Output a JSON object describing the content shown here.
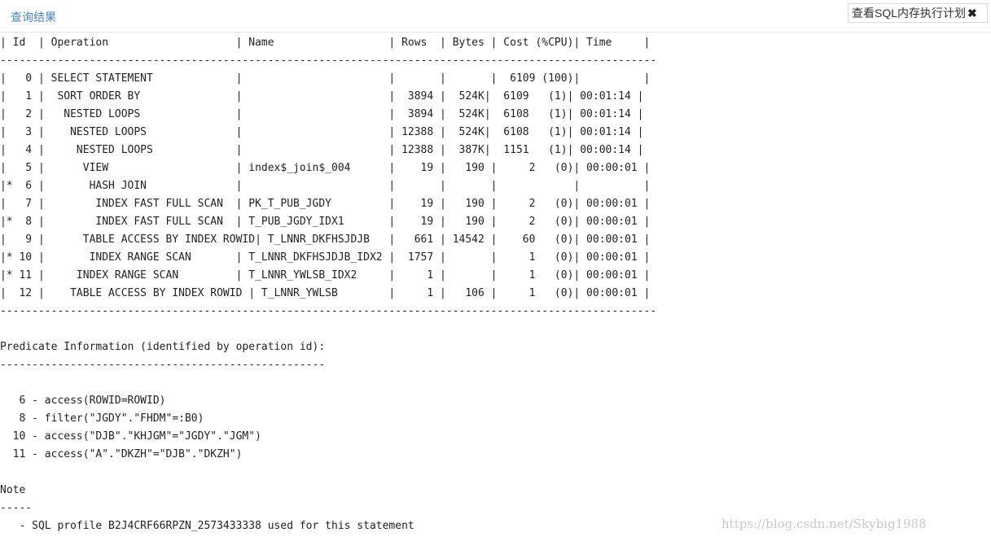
{
  "header": {
    "title": "查询结果",
    "button_label": "查看SQL内存执行计划",
    "close_glyph": "✖"
  },
  "plan": {
    "lines": [
      "| Id  | Operation                    | Name                  | Rows  | Bytes | Cost (%CPU)| Time     |",
      "-------------------------------------------------------------------------------------------------------",
      "|   0 | SELECT STATEMENT             |                       |       |       |  6109 (100)|          |",
      "|   1 |  SORT ORDER BY               |                       |  3894 |  524K|  6109   (1)| 00:01:14 |",
      "|   2 |   NESTED LOOPS               |                       |  3894 |  524K|  6108   (1)| 00:01:14 |",
      "|   3 |    NESTED LOOPS              |                       | 12388 |  524K|  6108   (1)| 00:01:14 |",
      "|   4 |     NESTED LOOPS             |                       | 12388 |  387K|  1151   (1)| 00:00:14 |",
      "|   5 |      VIEW                    | index$_join$_004      |    19 |   190 |     2   (0)| 00:00:01 |",
      "|*  6 |       HASH JOIN              |                       |       |       |            |          |",
      "|   7 |        INDEX FAST FULL SCAN  | PK_T_PUB_JGDY         |    19 |   190 |     2   (0)| 00:00:01 |",
      "|*  8 |        INDEX FAST FULL SCAN  | T_PUB_JGDY_IDX1       |    19 |   190 |     2   (0)| 00:00:01 |",
      "|   9 |      TABLE ACCESS BY INDEX ROWID| T_LNNR_DKFHSJDJB   |   661 | 14542 |    60   (0)| 00:00:01 |",
      "|* 10 |       INDEX RANGE SCAN       | T_LNNR_DKFHSJDJB_IDX2 |  1757 |       |     1   (0)| 00:00:01 |",
      "|* 11 |     INDEX RANGE SCAN         | T_LNNR_YWLSB_IDX2     |     1 |       |     1   (0)| 00:00:01 |",
      "|  12 |    TABLE ACCESS BY INDEX ROWID | T_LNNR_YWLSB        |     1 |   106 |     1   (0)| 00:00:01 |",
      "-------------------------------------------------------------------------------------------------------",
      "",
      "Predicate Information (identified by operation id):",
      "---------------------------------------------------",
      "",
      "   6 - access(ROWID=ROWID)",
      "   8 - filter(\"JGDY\".\"FHDM\"=:B0)",
      "  10 - access(\"DJB\".\"KHJGM\"=\"JGDY\".\"JGM\")",
      "  11 - access(\"A\".\"DKZH\"=\"DJB\".\"DKZH\")",
      "",
      "Note",
      "-----",
      "   - SQL profile B2J4CRF66RPZN_2573433338 used for this statement"
    ]
  },
  "watermark": "https://blog.csdn.net/Skybig1988"
}
